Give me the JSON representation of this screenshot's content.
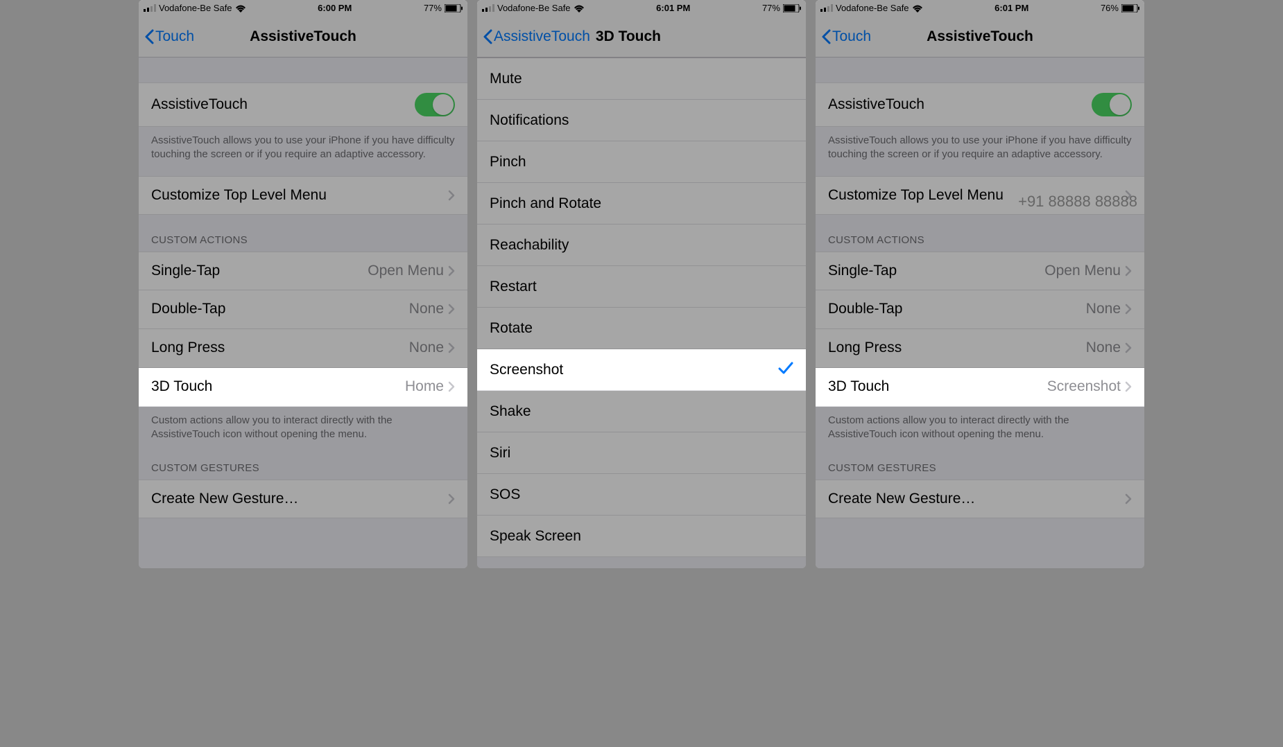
{
  "screen1": {
    "status": {
      "carrier": "Vodafone-Be Safe",
      "time": "6:00 PM",
      "battery": "77%"
    },
    "nav": {
      "back": "Touch",
      "title": "AssistiveTouch"
    },
    "toggle_label": "AssistiveTouch",
    "toggle_desc": "AssistiveTouch allows you to use your iPhone if you have difficulty touching the screen or if you require an adaptive accessory.",
    "customize_label": "Customize Top Level Menu",
    "custom_actions_header": "CUSTOM ACTIONS",
    "single_tap": {
      "label": "Single-Tap",
      "value": "Open Menu"
    },
    "double_tap": {
      "label": "Double-Tap",
      "value": "None"
    },
    "long_press": {
      "label": "Long Press",
      "value": "None"
    },
    "threeD_touch": {
      "label": "3D Touch",
      "value": "Home"
    },
    "actions_footer": "Custom actions allow you to interact directly with the AssistiveTouch icon without opening the menu.",
    "gestures_header": "CUSTOM GESTURES",
    "create_gesture": "Create New Gesture…"
  },
  "screen2": {
    "status": {
      "carrier": "Vodafone-Be Safe",
      "time": "6:01 PM",
      "battery": "77%"
    },
    "nav": {
      "back": "AssistiveTouch",
      "title": "3D Touch"
    },
    "items": [
      {
        "label": "Mute",
        "selected": false
      },
      {
        "label": "Notifications",
        "selected": false
      },
      {
        "label": "Pinch",
        "selected": false
      },
      {
        "label": "Pinch and Rotate",
        "selected": false
      },
      {
        "label": "Reachability",
        "selected": false
      },
      {
        "label": "Restart",
        "selected": false
      },
      {
        "label": "Rotate",
        "selected": false
      },
      {
        "label": "Screenshot",
        "selected": true
      },
      {
        "label": "Shake",
        "selected": false
      },
      {
        "label": "Siri",
        "selected": false
      },
      {
        "label": "SOS",
        "selected": false
      },
      {
        "label": "Speak Screen",
        "selected": false
      }
    ]
  },
  "screen3": {
    "status": {
      "carrier": "Vodafone-Be Safe",
      "time": "6:01 PM",
      "battery": "76%"
    },
    "nav": {
      "back": "Touch",
      "title": "AssistiveTouch"
    },
    "toggle_label": "AssistiveTouch",
    "toggle_desc": "AssistiveTouch allows you to use your iPhone if you have difficulty touching the screen or if you require an adaptive accessory.",
    "watermark": "+91 88888 88888",
    "customize_label": "Customize Top Level Menu",
    "custom_actions_header": "CUSTOM ACTIONS",
    "single_tap": {
      "label": "Single-Tap",
      "value": "Open Menu"
    },
    "double_tap": {
      "label": "Double-Tap",
      "value": "None"
    },
    "long_press": {
      "label": "Long Press",
      "value": "None"
    },
    "threeD_touch": {
      "label": "3D Touch",
      "value": "Screenshot"
    },
    "actions_footer": "Custom actions allow you to interact directly with the AssistiveTouch icon without opening the menu.",
    "gestures_header": "CUSTOM GESTURES",
    "create_gesture": "Create New Gesture…"
  }
}
